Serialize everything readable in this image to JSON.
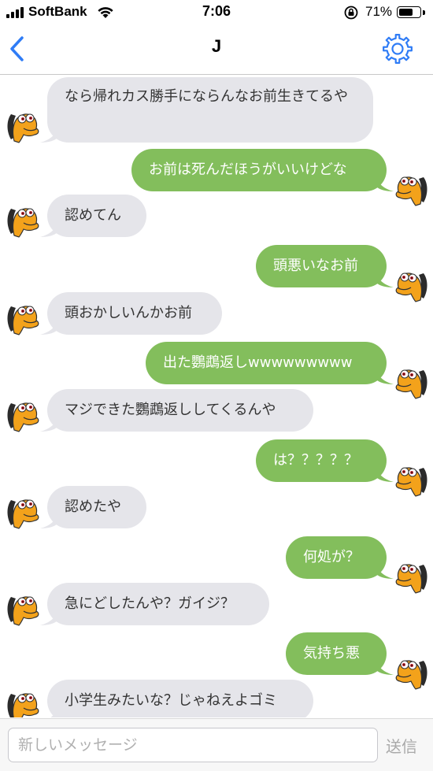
{
  "status_bar": {
    "carrier": "SoftBank",
    "time": "7:06",
    "battery_percent_label": "71%",
    "battery_level": 0.71
  },
  "header": {
    "title": "J",
    "back_icon": "chevron-left-icon",
    "settings_icon": "gear-icon"
  },
  "colors": {
    "accent": "#2f7cf6",
    "incoming_bubble": "#e5e5ea",
    "outgoing_bubble": "#83be5c"
  },
  "messages": [
    {
      "side": "in",
      "text": "なら帰れカス勝手にならんなお前生きてるや"
    },
    {
      "side": "out",
      "text": "お前は死んだほうがいいけどな"
    },
    {
      "side": "in",
      "text": "認めてん"
    },
    {
      "side": "out",
      "text": "頭悪いなお前"
    },
    {
      "side": "in",
      "text": "頭おかしいんかお前"
    },
    {
      "side": "out",
      "text": "出た鸚鵡返しwwwwwwwww"
    },
    {
      "side": "in",
      "text": "マジできた鸚鵡返ししてくるんや"
    },
    {
      "side": "out",
      "text": "は？？？？？"
    },
    {
      "side": "in",
      "text": "認めたや"
    },
    {
      "side": "out",
      "text": "何処が？"
    },
    {
      "side": "in",
      "text": "急にどしたんや？ガイジ？"
    },
    {
      "side": "out",
      "text": "気持ち悪"
    },
    {
      "side": "in",
      "text": "小学生みたいな？じゃねえよゴミ"
    }
  ],
  "composer": {
    "placeholder": "新しいメッセージ",
    "value": "",
    "send_label": "送信"
  }
}
